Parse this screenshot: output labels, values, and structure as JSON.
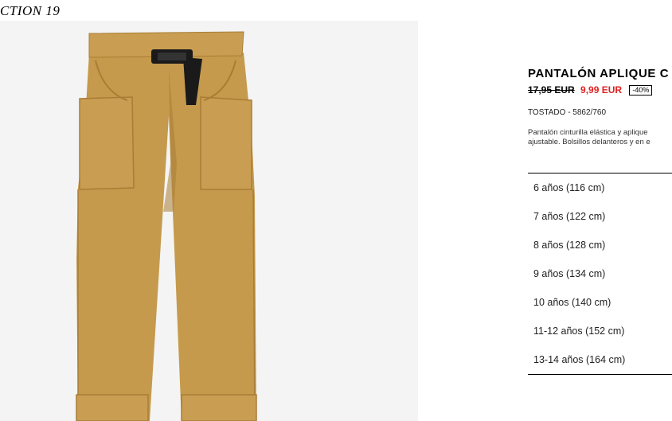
{
  "collection_label": "CTION 19",
  "product": {
    "title": "PANTALÓN APLIQUE C",
    "old_price": "17,95 EUR",
    "sale_price": "9,99 EUR",
    "discount": "-40%",
    "color_ref": "TOSTADO - 5862/760",
    "description_line1": "Pantalón cinturilla elástica y aplique",
    "description_line2": "ajustable. Bolsillos delanteros y en e"
  },
  "sizes": [
    "6 años (116 cm)",
    "7 años (122 cm)",
    "8 años (128 cm)",
    "9 años (134 cm)",
    "10 años (140 cm)",
    "11-12 años (152 cm)",
    "13-14 años (164 cm)"
  ],
  "colors": {
    "pants": "#c59a4c",
    "pants_shadow": "#a87d36",
    "image_bg": "#f4f4f4",
    "sale_price": "#e02020"
  },
  "icons": [
    "buckle-icon"
  ]
}
